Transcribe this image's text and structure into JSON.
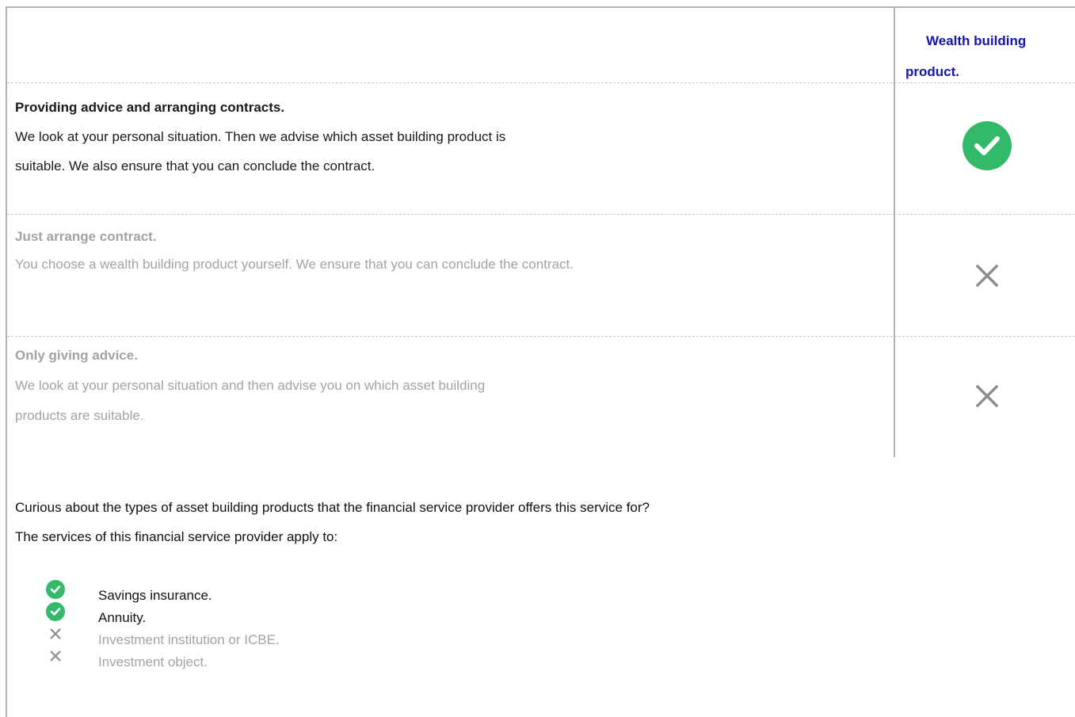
{
  "header": {
    "column_title_line1": "Wealth building",
    "column_title_line2": "product."
  },
  "rows": [
    {
      "title": "Providing advice and arranging contracts.",
      "desc_line1": "We look at your personal situation. Then we advise which asset building product is",
      "desc_line2": "suitable. We also ensure that you can conclude the contract.",
      "status": "check-circle-icon"
    },
    {
      "title": "Just arrange contract.",
      "desc_line1": "You choose a wealth building product yourself. We ensure that you can conclude the contract.",
      "status": "cross-icon"
    },
    {
      "title": "Only giving advice.",
      "desc_line1": "We look at your personal situation and then advise you on which asset building",
      "desc_line2": "products are suitable.",
      "status": "cross-icon"
    }
  ],
  "info": {
    "question": "Curious about the types of asset building products that the financial service provider offers this service for?",
    "applies_to": "The services of this financial service provider apply to:"
  },
  "services": [
    {
      "label": "Savings insurance.",
      "available": true
    },
    {
      "label": "Annuity.",
      "available": true
    },
    {
      "label": "Investment institution or ICBE.",
      "available": false
    },
    {
      "label": "Investment object.",
      "available": false
    }
  ],
  "colors": {
    "accent_blue": "#1414b4",
    "check_green": "#33b96a",
    "inactive_gray": "#a3a3a3",
    "border_gray": "#b3b3b3"
  }
}
